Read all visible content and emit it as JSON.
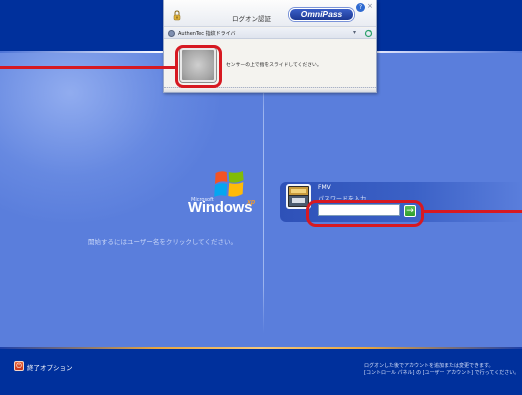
{
  "omnipass": {
    "title": "ログオン認証",
    "logo_text": "OmniPass",
    "help_label": "?",
    "close_label": "×",
    "device_label": "AuthenTec 指紋ドライバ",
    "instruction": "センサーの上で指をスライドしてください。"
  },
  "welcome": {
    "microsoft_text": "Microsoft",
    "windows_text": "Windows",
    "xp_text": "xp",
    "instruction": "開始するにはユーザー名をクリックしてください。"
  },
  "user": {
    "name": "FMV",
    "password_label": "パスワードを入力",
    "password_value": "",
    "go_label": "→"
  },
  "footer": {
    "shutdown_label": "終了オプション",
    "note_line1": "ログオンした後でアカウントを追加または変更できます。",
    "note_line2": "[コントロール パネル] の [ユーザー アカウント] で行ってください。"
  },
  "colors": {
    "band": "#00309c",
    "background": "#5a7edc",
    "callout": "#d71921",
    "accent_orange": "#f39c2e"
  },
  "icons": {
    "flag": "windows-flag-icon",
    "lock": "lock-icon",
    "device": "fingerprint-device-icon",
    "refresh": "refresh-icon",
    "shutdown": "power-icon",
    "go": "arrow-right-icon",
    "help": "help-icon",
    "close": "close-icon"
  }
}
